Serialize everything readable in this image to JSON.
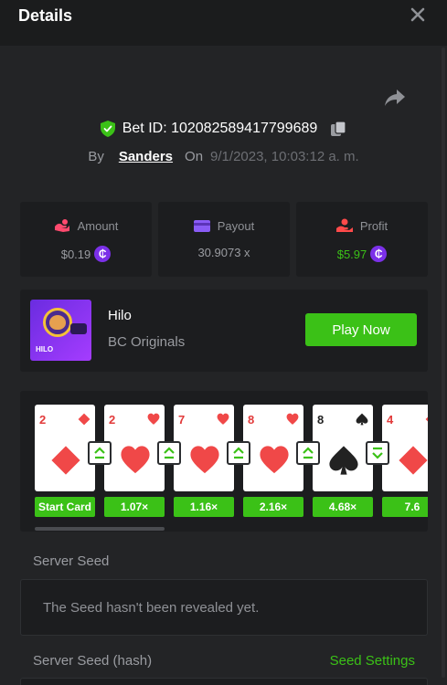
{
  "header": {
    "title": "Details",
    "close_icon": "close-icon"
  },
  "bet": {
    "bet_id_label": "Bet ID: 102082589417799689",
    "by_label": "By",
    "username": "Sanders",
    "on_label": "On",
    "date": "9/1/2023, 10:03:12 a. m."
  },
  "stats": {
    "amount": {
      "label": "Amount",
      "value": "$0.19",
      "icon": "amount-icon"
    },
    "payout": {
      "label": "Payout",
      "value": "30.9073 x",
      "icon": "payout-icon"
    },
    "profit": {
      "label": "Profit",
      "value": "$5.97",
      "icon": "profit-icon"
    },
    "coin_symbol": "₵"
  },
  "game": {
    "name": "Hilo",
    "provider": "BC Originals",
    "play_label": "Play Now",
    "thumb_label": "HILO"
  },
  "cards": [
    {
      "rank": "2",
      "suit": "diamond",
      "color": "red",
      "multiplier": "Start Card"
    },
    {
      "rank": "2",
      "suit": "heart",
      "color": "red",
      "multiplier": "1.07×",
      "guess": "higher"
    },
    {
      "rank": "7",
      "suit": "heart",
      "color": "red",
      "multiplier": "1.16×",
      "guess": "higher"
    },
    {
      "rank": "8",
      "suit": "heart",
      "color": "red",
      "multiplier": "2.16×",
      "guess": "higher"
    },
    {
      "rank": "8",
      "suit": "spade",
      "color": "black",
      "multiplier": "4.68×",
      "guess": "higher"
    },
    {
      "rank": "4",
      "suit": "diamond",
      "color": "red",
      "multiplier": "7.6",
      "guess": "lower"
    }
  ],
  "seeds": {
    "server_seed_label": "Server Seed",
    "server_seed_value": "The Seed hasn't been revealed yet.",
    "server_seed_hash_label": "Server Seed (hash)",
    "seed_settings_label": "Seed Settings"
  },
  "colors": {
    "accent_green": "#3bc117",
    "coin_purple": "#7b30e8",
    "background": "#232426",
    "panel": "#1c1d1f"
  }
}
